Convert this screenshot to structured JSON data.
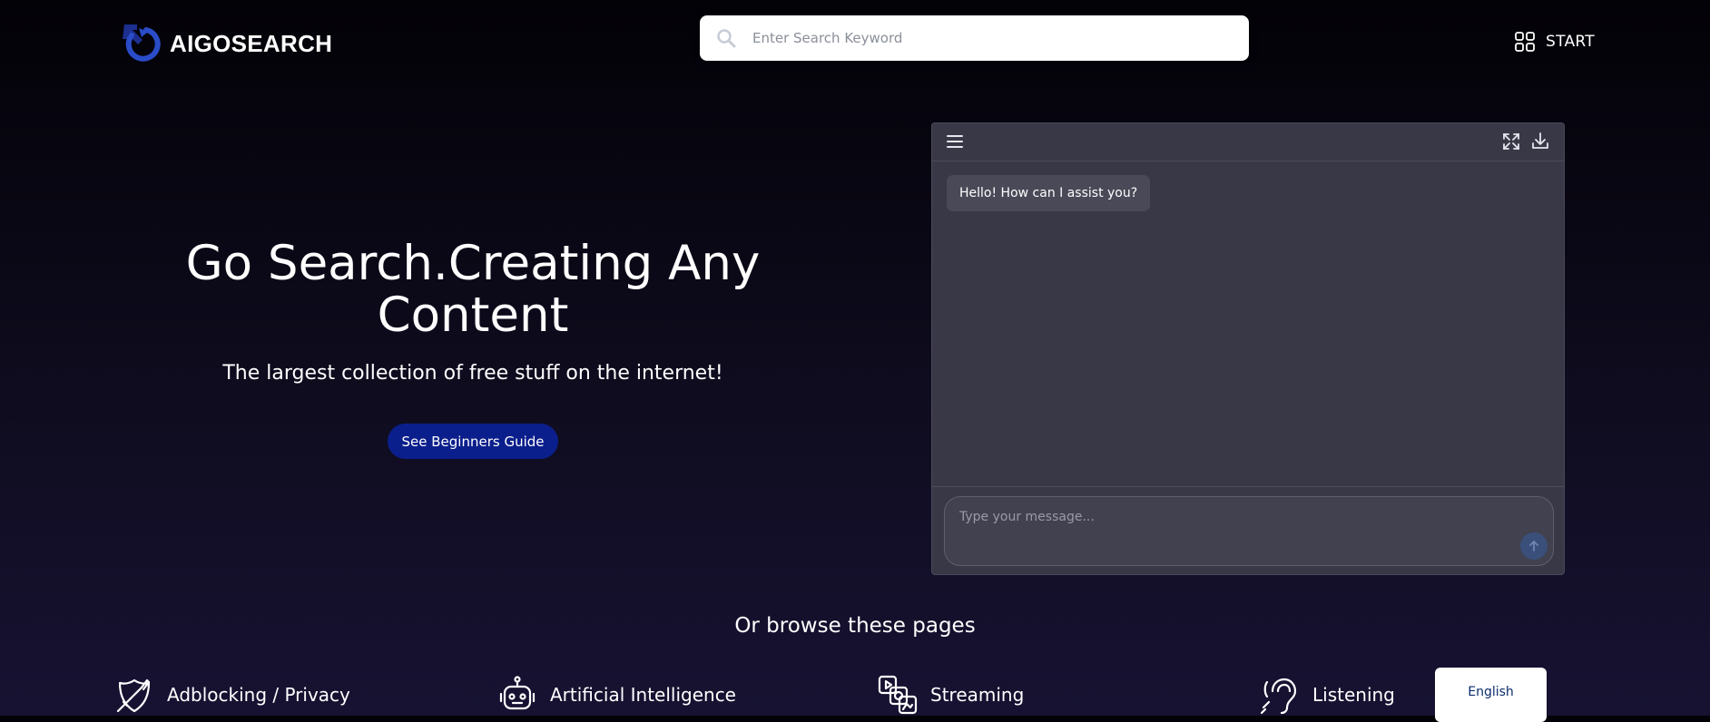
{
  "header": {
    "logo_text": "AIGOSEARCH",
    "logo_icon": "refresh-arrow-logo",
    "search": {
      "placeholder": "Enter Search Keyword",
      "icon": "search-icon"
    },
    "start_label": "START",
    "start_icon": "grid-icon"
  },
  "hero": {
    "title_line1": "Go Search.Creating Any",
    "title_line2": "Content",
    "subtitle": "The largest collection of free stuff on the internet!",
    "guide_button": "See Beginners Guide"
  },
  "chat": {
    "greeting": "Hello! How can I assist you?",
    "input_placeholder": "Type your message...",
    "icons": [
      "menu-icon",
      "expand-icon",
      "download-icon",
      "send-arrow-icon"
    ]
  },
  "browse": {
    "title": "Or browse these pages",
    "categories": [
      {
        "label": "Adblocking / Privacy",
        "icon": "shield-sword-icon"
      },
      {
        "label": "Artificial Intelligence",
        "icon": "robot-icon"
      },
      {
        "label": "Streaming",
        "icon": "streaming-media-icon"
      },
      {
        "label": "Listening",
        "icon": "ear-icon"
      }
    ]
  },
  "language_button": "English",
  "colors": {
    "accent_blue": "#0b1f8c",
    "logo_blue": "#1f3fb0",
    "chat_bg": "#393847"
  }
}
